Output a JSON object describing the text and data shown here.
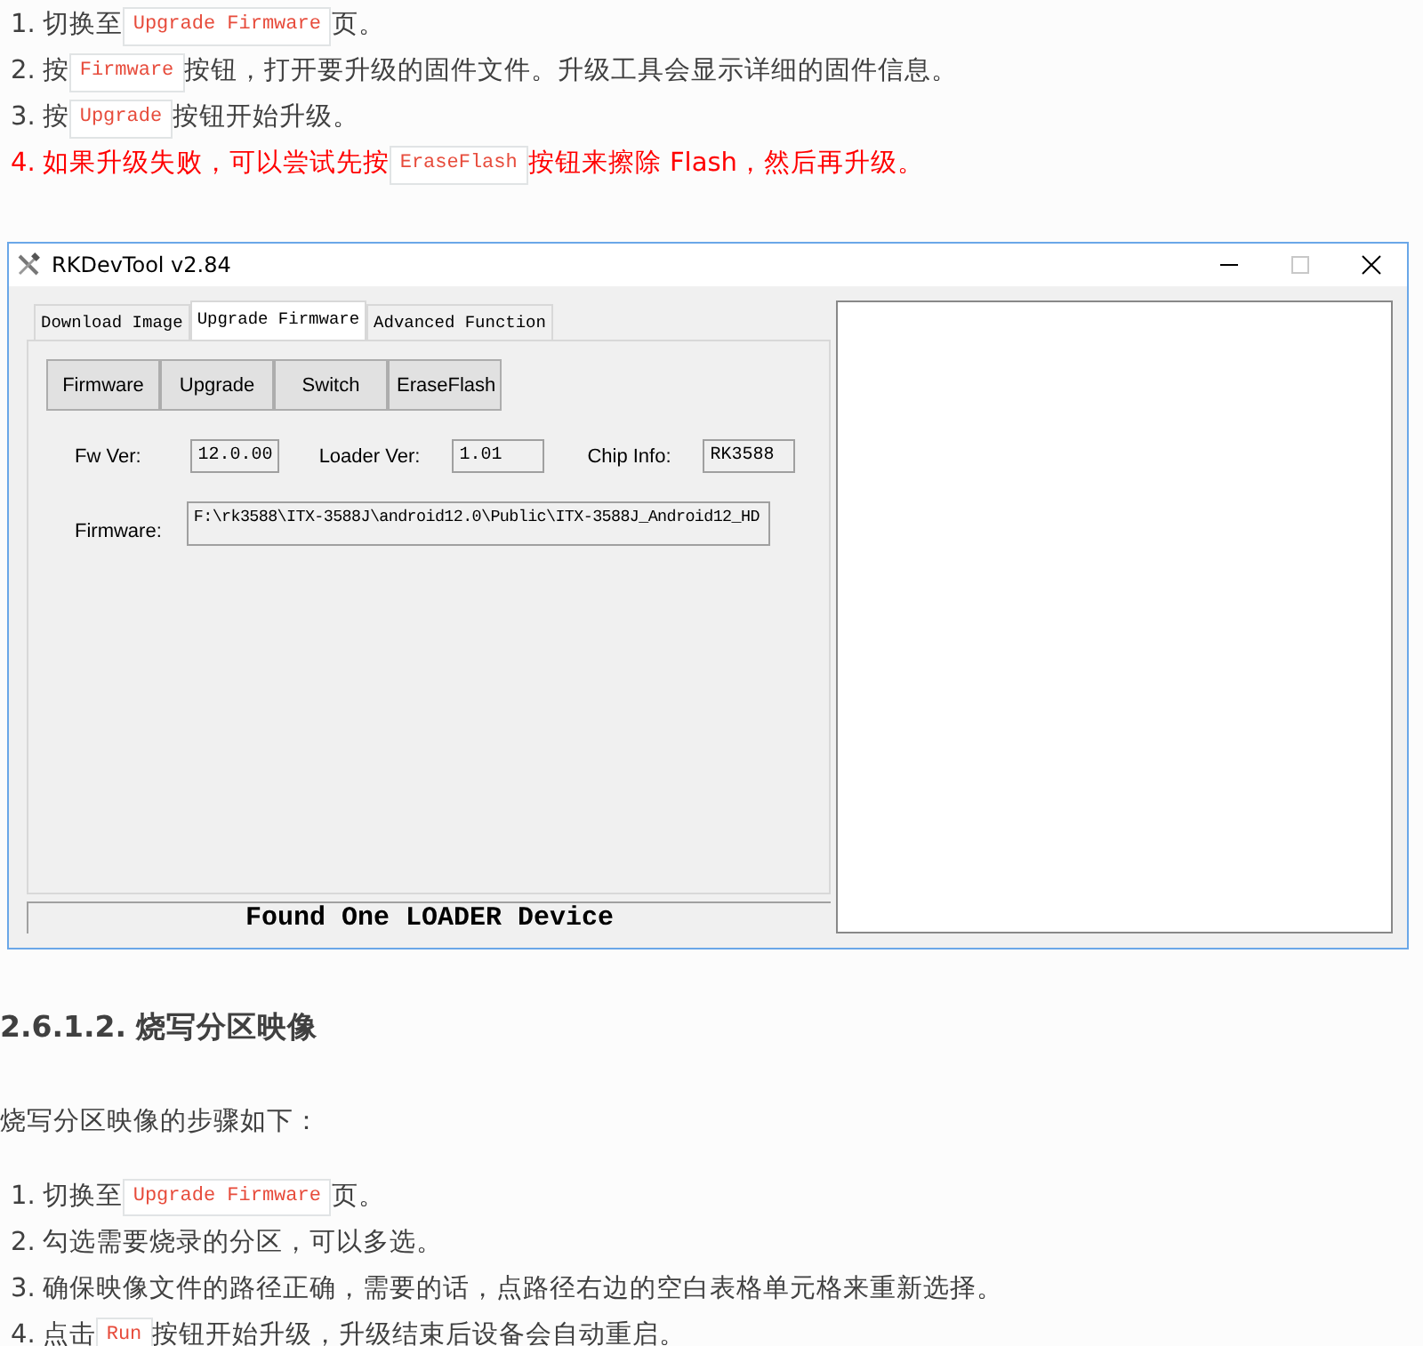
{
  "steps_top": [
    {
      "number": "1.",
      "kind": "normal",
      "parts": [
        {
          "kind": "text",
          "text": "切换至"
        },
        {
          "kind": "code",
          "text": "Upgrade Firmware"
        },
        {
          "kind": "text",
          "text": "页。"
        }
      ]
    },
    {
      "number": "2.",
      "kind": "normal",
      "parts": [
        {
          "kind": "text",
          "text": "按"
        },
        {
          "kind": "code",
          "text": "Firmware"
        },
        {
          "kind": "text",
          "text": "按钮，打开要升级的固件文件。升级工具会显示详细的固件信息。"
        }
      ]
    },
    {
      "number": "3.",
      "kind": "normal",
      "parts": [
        {
          "kind": "text",
          "text": "按"
        },
        {
          "kind": "code",
          "text": "Upgrade"
        },
        {
          "kind": "text",
          "text": "按钮开始升级。"
        }
      ]
    },
    {
      "number": "4.",
      "kind": "warning",
      "parts": [
        {
          "kind": "text",
          "text": "如果升级失败，可以尝试先按"
        },
        {
          "kind": "code",
          "text": "EraseFlash"
        },
        {
          "kind": "text",
          "text": "按钮来擦除 Flash，然后再升级。"
        }
      ]
    }
  ],
  "window": {
    "title": "RKDevTool v2.84",
    "controls": [
      {
        "kind": "minimize",
        "disabled": false
      },
      {
        "kind": "maximize",
        "disabled": true
      },
      {
        "kind": "close",
        "disabled": false
      }
    ],
    "tabs": [
      {
        "label": "Download Image",
        "selected": false
      },
      {
        "label": "Upgrade Firmware",
        "selected": true
      },
      {
        "label": "Advanced Function",
        "selected": false
      }
    ],
    "buttons": [
      "Firmware",
      "Upgrade",
      "Switch",
      "EraseFlash"
    ],
    "info_fields": [
      {
        "label": "Fw Ver:",
        "value": "12.0.00"
      },
      {
        "label": "Loader Ver:",
        "value": "1.01"
      },
      {
        "label": "Chip Info:",
        "value": "RK3588"
      }
    ],
    "firmware_field": {
      "label": "Firmware:",
      "value": "F:\\rk3588\\ITX-3588J\\android12.0\\Public\\ITX-3588J_Android12_HD"
    },
    "status_bar": "Found One LOADER Device"
  },
  "heading": "2.6.1.2. 烧写分区映像",
  "intro": "烧写分区映像的步骤如下：",
  "steps_bottom": [
    {
      "number": "1.",
      "kind": "normal",
      "parts": [
        {
          "kind": "text",
          "text": "切换至"
        },
        {
          "kind": "code",
          "text": "Upgrade Firmware"
        },
        {
          "kind": "text",
          "text": "页。"
        }
      ]
    },
    {
      "number": "2.",
      "kind": "normal",
      "parts": [
        {
          "kind": "text",
          "text": "勾选需要烧录的分区，可以多选。"
        }
      ]
    },
    {
      "number": "3.",
      "kind": "normal",
      "parts": [
        {
          "kind": "text",
          "text": "确保映像文件的路径正确，需要的话，点路径右边的空白表格单元格来重新选择。"
        }
      ]
    },
    {
      "number": "4.",
      "kind": "normal",
      "parts": [
        {
          "kind": "text",
          "text": "点击"
        },
        {
          "kind": "code",
          "text": "Run"
        },
        {
          "kind": "text",
          "text": "按钮开始升级，升级结束后设备会自动重启。"
        }
      ]
    }
  ]
}
